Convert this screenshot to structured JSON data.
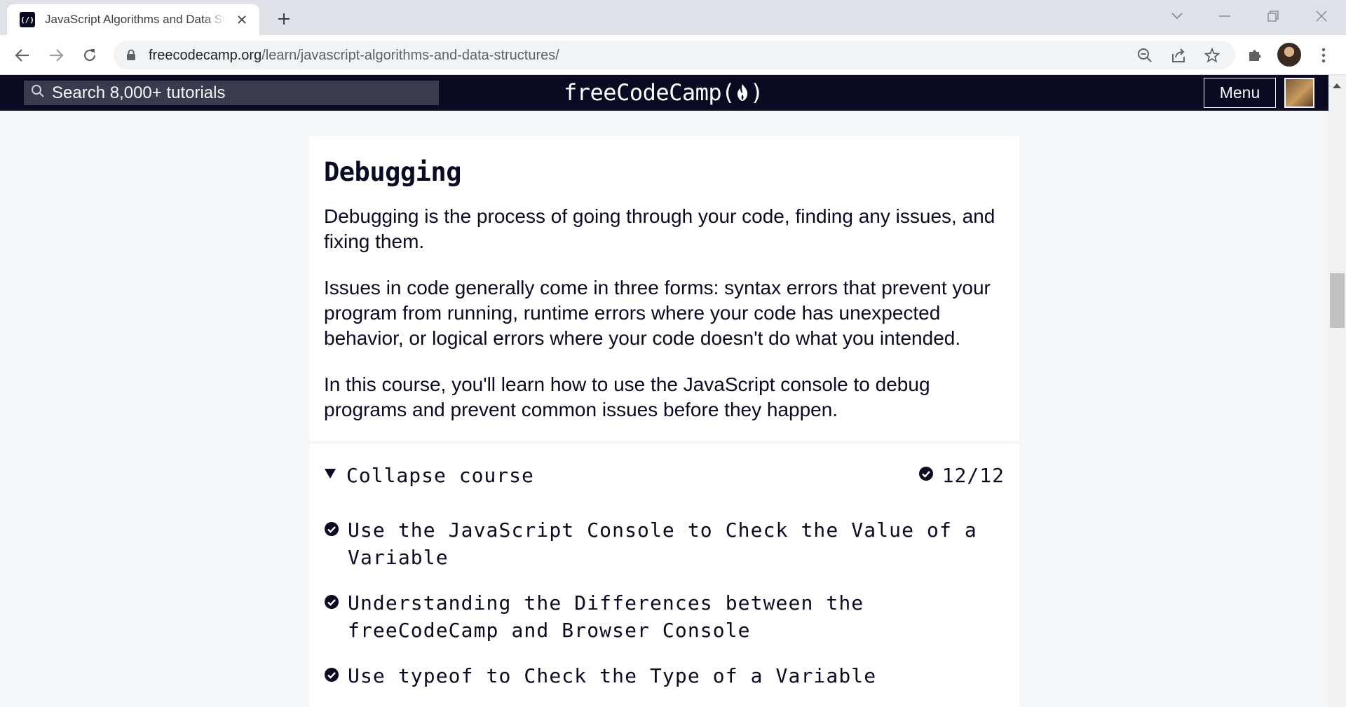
{
  "browser": {
    "tab_title": "JavaScript Algorithms and Data Structures",
    "favicon_text": "(/)",
    "url_host": "freecodecamp.org",
    "url_path": "/learn/javascript-algorithms-and-data-structures/"
  },
  "nav": {
    "search_placeholder": "Search 8,000+ tutorials",
    "logo_text": "freeCodeCamp(",
    "logo_close": ")",
    "menu_label": "Menu"
  },
  "section": {
    "title": "Debugging",
    "paragraphs": [
      "Debugging is the process of going through your code, finding any issues, and fixing them.",
      "Issues in code generally come in three forms: syntax errors that prevent your program from running, runtime errors where your code has unexpected behavior, or logical errors where your code doesn't do what you intended.",
      "In this course, you'll learn how to use the JavaScript console to debug programs and prevent common issues before they happen."
    ],
    "collapse_label": "Collapse course",
    "progress": "12/12",
    "challenges": [
      "Use the JavaScript Console to Check the Value of a Variable",
      "Understanding the Differences between the freeCodeCamp and Browser Console",
      "Use typeof to Check the Type of a Variable"
    ]
  },
  "colors": {
    "nav_bg": "#0a0a23",
    "search_bg": "#3b3b4f",
    "page_bg": "#f5f6f7",
    "text": "#0a0a23"
  },
  "icons": {
    "tab_close": "close-icon",
    "new_tab": "plus-icon",
    "back": "arrow-left-icon",
    "forward": "arrow-right-icon",
    "reload": "reload-icon",
    "lock": "lock-icon",
    "zoom": "zoom-out-icon",
    "share": "share-icon",
    "bookmark": "star-icon",
    "extensions": "puzzle-icon",
    "more": "kebab-menu-icon",
    "search": "search-icon",
    "flame": "flame-icon",
    "collapse": "triangle-down-icon",
    "check": "check-circle-icon"
  }
}
